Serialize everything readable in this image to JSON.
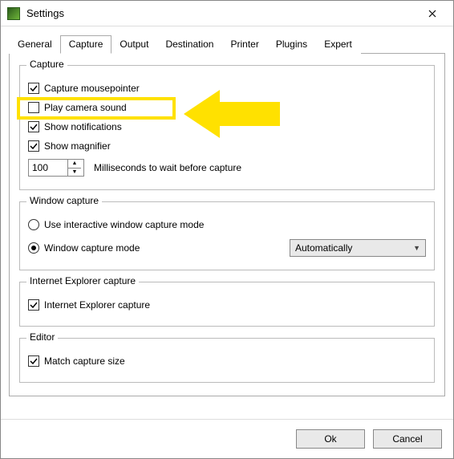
{
  "window": {
    "title": "Settings"
  },
  "tabs": [
    "General",
    "Capture",
    "Output",
    "Destination",
    "Printer",
    "Plugins",
    "Expert"
  ],
  "active_tab_index": 1,
  "groups": {
    "capture": {
      "legend": "Capture",
      "mousepointer": "Capture mousepointer",
      "camerasound": "Play camera sound",
      "notifications": "Show notifications",
      "magnifier": "Show magnifier",
      "delay_value": "100",
      "delay_label": "Milliseconds to wait before capture"
    },
    "windowcap": {
      "legend": "Window capture",
      "interactive": "Use interactive window capture mode",
      "mode": "Window capture mode",
      "mode_value": "Automatically"
    },
    "ie": {
      "legend": "Internet Explorer capture",
      "opt": "Internet Explorer capture"
    },
    "editor": {
      "legend": "Editor",
      "opt": "Match capture size"
    }
  },
  "footer": {
    "ok": "Ok",
    "cancel": "Cancel"
  },
  "checks": {
    "mousepointer": true,
    "camerasound": false,
    "notifications": true,
    "magnifier": true,
    "ie": true,
    "editor": true
  },
  "radio_selected": "mode"
}
